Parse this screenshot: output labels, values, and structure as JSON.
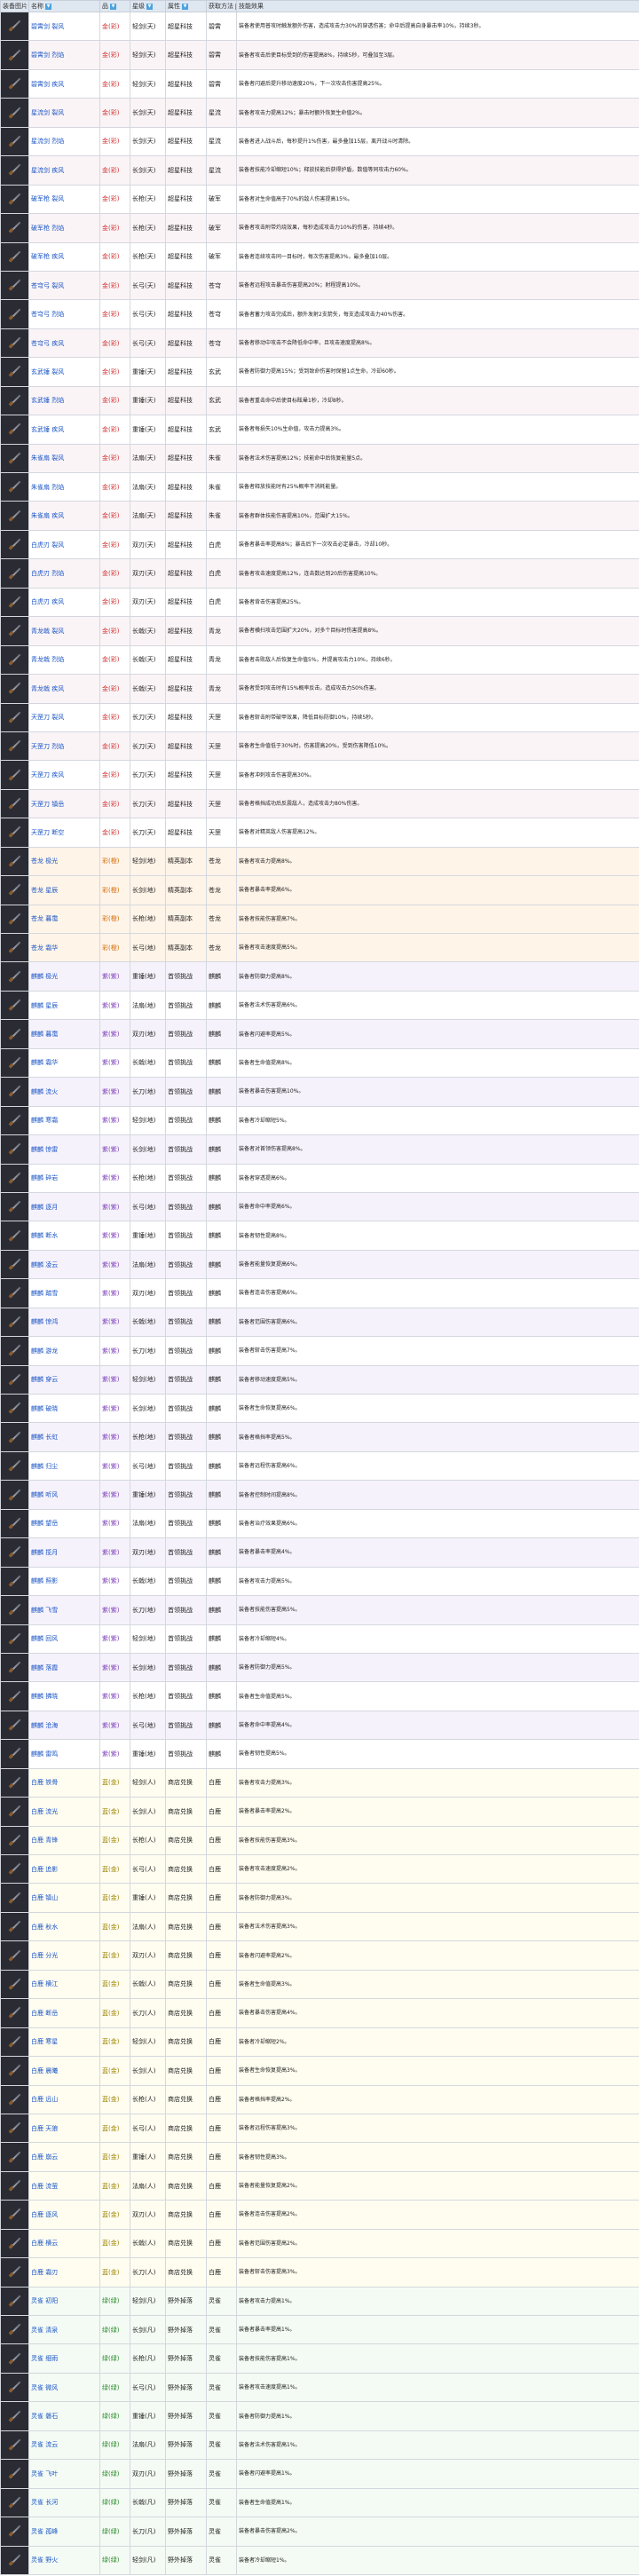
{
  "headers": [
    "装备图片",
    "名称",
    "品",
    "星级",
    "属性",
    "获取方法",
    "技能效果"
  ],
  "rows": [
    {
      "name": "碧霄剑 裂风",
      "grade": "金(彩)",
      "attr": "轻剑(天)",
      "source": "超星科技",
      "aff": "碧霄",
      "desc": "装备者使用普攻时触发额外伤害，造成攻击力30%的穿透伤害；命中后提高自身暴击率10%，持续3秒。",
      "tone": "red"
    },
    {
      "name": "碧霄剑 烈焰",
      "grade": "金(彩)",
      "attr": "轻剑(天)",
      "source": "超星科技",
      "aff": "碧霄",
      "desc": "装备者攻击后使目标受到的伤害提高8%，持续5秒，可叠加至3层。",
      "tone": "red"
    },
    {
      "name": "碧霄剑 疾风",
      "grade": "金(彩)",
      "attr": "轻剑(天)",
      "source": "超星科技",
      "aff": "碧霄",
      "desc": "装备者闪避后提升移动速度20%，下一次攻击伤害提高25%。",
      "tone": "red"
    },
    {
      "name": "星流剑 裂风",
      "grade": "金(彩)",
      "attr": "长剑(天)",
      "source": "超星科技",
      "aff": "星流",
      "desc": "装备者攻击力提高12%；暴击时额外恢复生命值2%。",
      "tone": "red"
    },
    {
      "name": "星流剑 烈焰",
      "grade": "金(彩)",
      "attr": "长剑(天)",
      "source": "超星科技",
      "aff": "星流",
      "desc": "装备者进入战斗后，每秒提升1%伤害，最多叠加15层，离开战斗时清除。",
      "tone": "red"
    },
    {
      "name": "星流剑 疾风",
      "grade": "金(彩)",
      "attr": "长剑(天)",
      "source": "超星科技",
      "aff": "星流",
      "desc": "装备者技能冷却缩短10%；释放技能后获得护盾，数值等同攻击力60%。",
      "tone": "red"
    },
    {
      "name": "破军枪 裂风",
      "grade": "金(彩)",
      "attr": "长枪(天)",
      "source": "超星科技",
      "aff": "破军",
      "desc": "装备者对生命值高于70%的敌人伤害提高15%。",
      "tone": "red"
    },
    {
      "name": "破军枪 烈焰",
      "grade": "金(彩)",
      "attr": "长枪(天)",
      "source": "超星科技",
      "aff": "破军",
      "desc": "装备者攻击附带灼烧效果，每秒造成攻击力10%的伤害，持续4秒。",
      "tone": "red"
    },
    {
      "name": "破军枪 疾风",
      "grade": "金(彩)",
      "attr": "长枪(天)",
      "source": "超星科技",
      "aff": "破军",
      "desc": "装备者连续攻击同一目标时，每次伤害提高3%，最多叠加10层。",
      "tone": "red"
    },
    {
      "name": "苍穹弓 裂风",
      "grade": "金(彩)",
      "attr": "长弓(天)",
      "source": "超星科技",
      "aff": "苍穹",
      "desc": "装备者远程攻击暴击伤害提高20%；射程提高10%。",
      "tone": "red"
    },
    {
      "name": "苍穹弓 烈焰",
      "grade": "金(彩)",
      "attr": "长弓(天)",
      "source": "超星科技",
      "aff": "苍穹",
      "desc": "装备者蓄力攻击完成后，额外发射2支箭矢，每支造成攻击力40%伤害。",
      "tone": "red"
    },
    {
      "name": "苍穹弓 疾风",
      "grade": "金(彩)",
      "attr": "长弓(天)",
      "source": "超星科技",
      "aff": "苍穹",
      "desc": "装备者移动中攻击不会降低命中率，且攻击速度提高8%。",
      "tone": "red"
    },
    {
      "name": "玄武锤 裂风",
      "grade": "金(彩)",
      "attr": "重锤(天)",
      "source": "超星科技",
      "aff": "玄武",
      "desc": "装备者防御力提高15%；受到致命伤害时保留1点生命，冷却60秒。",
      "tone": "red"
    },
    {
      "name": "玄武锤 烈焰",
      "grade": "金(彩)",
      "attr": "重锤(天)",
      "source": "超星科技",
      "aff": "玄武",
      "desc": "装备者重击命中后使目标眩晕1秒，冷却8秒。",
      "tone": "red"
    },
    {
      "name": "玄武锤 疾风",
      "grade": "金(彩)",
      "attr": "重锤(天)",
      "source": "超星科技",
      "aff": "玄武",
      "desc": "装备者每损失10%生命值，攻击力提高3%。",
      "tone": "red"
    },
    {
      "name": "朱雀扇 裂风",
      "grade": "金(彩)",
      "attr": "法扇(天)",
      "source": "超星科技",
      "aff": "朱雀",
      "desc": "装备者法术伤害提高12%；技能命中后恢复能量5点。",
      "tone": "red"
    },
    {
      "name": "朱雀扇 烈焰",
      "grade": "金(彩)",
      "attr": "法扇(天)",
      "source": "超星科技",
      "aff": "朱雀",
      "desc": "装备者释放技能时有25%概率不消耗能量。",
      "tone": "red"
    },
    {
      "name": "朱雀扇 疾风",
      "grade": "金(彩)",
      "attr": "法扇(天)",
      "source": "超星科技",
      "aff": "朱雀",
      "desc": "装备者群体技能伤害提高10%，范围扩大15%。",
      "tone": "red"
    },
    {
      "name": "白虎刃 裂风",
      "grade": "金(彩)",
      "attr": "双刃(天)",
      "source": "超星科技",
      "aff": "白虎",
      "desc": "装备者暴击率提高8%；暴击后下一次攻击必定暴击，冷却10秒。",
      "tone": "red"
    },
    {
      "name": "白虎刃 烈焰",
      "grade": "金(彩)",
      "attr": "双刃(天)",
      "source": "超星科技",
      "aff": "白虎",
      "desc": "装备者攻击速度提高12%，连击数达到20后伤害提高10%。",
      "tone": "red"
    },
    {
      "name": "白虎刃 疾风",
      "grade": "金(彩)",
      "attr": "双刃(天)",
      "source": "超星科技",
      "aff": "白虎",
      "desc": "装备者背击伤害提高25%。",
      "tone": "red"
    },
    {
      "name": "青龙戟 裂风",
      "grade": "金(彩)",
      "attr": "长戟(天)",
      "source": "超星科技",
      "aff": "青龙",
      "desc": "装备者横扫攻击范围扩大20%，对多个目标时伤害提高8%。",
      "tone": "red"
    },
    {
      "name": "青龙戟 烈焰",
      "grade": "金(彩)",
      "attr": "长戟(天)",
      "source": "超星科技",
      "aff": "青龙",
      "desc": "装备者击败敌人后恢复生命值5%，并提高攻击力10%，持续6秒。",
      "tone": "red"
    },
    {
      "name": "青龙戟 疾风",
      "grade": "金(彩)",
      "attr": "长戟(天)",
      "source": "超星科技",
      "aff": "青龙",
      "desc": "装备者受到攻击时有15%概率反击，造成攻击力50%伤害。",
      "tone": "red"
    },
    {
      "name": "天罡刀 裂风",
      "grade": "金(彩)",
      "attr": "长刀(天)",
      "source": "超星科技",
      "aff": "天罡",
      "desc": "装备者斩击附带破甲效果，降低目标防御10%，持续5秒。",
      "tone": "red"
    },
    {
      "name": "天罡刀 烈焰",
      "grade": "金(彩)",
      "attr": "长刀(天)",
      "source": "超星科技",
      "aff": "天罡",
      "desc": "装备者生命值低于30%时，伤害提高20%，受到伤害降低10%。",
      "tone": "red"
    },
    {
      "name": "天罡刀 疾风",
      "grade": "金(彩)",
      "attr": "长刀(天)",
      "source": "超星科技",
      "aff": "天罡",
      "desc": "装备者冲刺攻击伤害提高30%。",
      "tone": "red"
    },
    {
      "name": "天罡刀 镇岳",
      "grade": "金(彩)",
      "attr": "长刀(天)",
      "source": "超星科技",
      "aff": "天罡",
      "desc": "装备者格挡成功后反震敌人，造成攻击力80%伤害。",
      "tone": "red"
    },
    {
      "name": "天罡刀 断空",
      "grade": "金(彩)",
      "attr": "长刀(天)",
      "source": "超星科技",
      "aff": "天罡",
      "desc": "装备者对精英敌人伤害提高12%。",
      "tone": "red"
    },
    {
      "name": "苍龙 极光",
      "grade": "彩(橙)",
      "attr": "轻剑(地)",
      "source": "精英副本",
      "aff": "苍龙",
      "desc": "装备者攻击力提高8%。",
      "tone": "or"
    },
    {
      "name": "苍龙 星辰",
      "grade": "彩(橙)",
      "attr": "长剑(地)",
      "source": "精英副本",
      "aff": "苍龙",
      "desc": "装备者暴击率提高6%。",
      "tone": "or"
    },
    {
      "name": "苍龙 暮霭",
      "grade": "彩(橙)",
      "attr": "长枪(地)",
      "source": "精英副本",
      "aff": "苍龙",
      "desc": "装备者技能伤害提高7%。",
      "tone": "or"
    },
    {
      "name": "苍龙 霜华",
      "grade": "彩(橙)",
      "attr": "长弓(地)",
      "source": "精英副本",
      "aff": "苍龙",
      "desc": "装备者攻击速度提高5%。",
      "tone": "or"
    },
    {
      "name": "麒麟 极光",
      "grade": "紫(紫)",
      "attr": "重锤(地)",
      "source": "首领挑战",
      "aff": "麒麟",
      "desc": "装备者防御力提高8%。",
      "tone": "pu"
    },
    {
      "name": "麒麟 星辰",
      "grade": "紫(紫)",
      "attr": "法扇(地)",
      "source": "首领挑战",
      "aff": "麒麟",
      "desc": "装备者法术伤害提高6%。",
      "tone": "pu"
    },
    {
      "name": "麒麟 暮霭",
      "grade": "紫(紫)",
      "attr": "双刃(地)",
      "source": "首领挑战",
      "aff": "麒麟",
      "desc": "装备者闪避率提高5%。",
      "tone": "pu"
    },
    {
      "name": "麒麟 霜华",
      "grade": "紫(紫)",
      "attr": "长戟(地)",
      "source": "首领挑战",
      "aff": "麒麟",
      "desc": "装备者生命值提高8%。",
      "tone": "pu"
    },
    {
      "name": "麒麟 流火",
      "grade": "紫(紫)",
      "attr": "长刀(地)",
      "source": "首领挑战",
      "aff": "麒麟",
      "desc": "装备者暴击伤害提高10%。",
      "tone": "pu"
    },
    {
      "name": "麒麟 寒霜",
      "grade": "紫(紫)",
      "attr": "轻剑(地)",
      "source": "首领挑战",
      "aff": "麒麟",
      "desc": "装备者冷却缩短5%。",
      "tone": "pu"
    },
    {
      "name": "麒麟 惊雷",
      "grade": "紫(紫)",
      "attr": "长剑(地)",
      "source": "首领挑战",
      "aff": "麒麟",
      "desc": "装备者对首领伤害提高8%。",
      "tone": "pu"
    },
    {
      "name": "麒麟 碎岩",
      "grade": "紫(紫)",
      "attr": "长枪(地)",
      "source": "首领挑战",
      "aff": "麒麟",
      "desc": "装备者穿透提高6%。",
      "tone": "pu"
    },
    {
      "name": "麒麟 逐月",
      "grade": "紫(紫)",
      "attr": "长弓(地)",
      "source": "首领挑战",
      "aff": "麒麟",
      "desc": "装备者命中率提高6%。",
      "tone": "pu"
    },
    {
      "name": "麒麟 断水",
      "grade": "紫(紫)",
      "attr": "重锤(地)",
      "source": "首领挑战",
      "aff": "麒麟",
      "desc": "装备者韧性提高8%。",
      "tone": "pu"
    },
    {
      "name": "麒麟 凌云",
      "grade": "紫(紫)",
      "attr": "法扇(地)",
      "source": "首领挑战",
      "aff": "麒麟",
      "desc": "装备者能量恢复提高6%。",
      "tone": "pu"
    },
    {
      "name": "麒麟 踏雪",
      "grade": "紫(紫)",
      "attr": "双刃(地)",
      "source": "首领挑战",
      "aff": "麒麟",
      "desc": "装备者连击伤害提高6%。",
      "tone": "pu"
    },
    {
      "name": "麒麟 惊鸿",
      "grade": "紫(紫)",
      "attr": "长戟(地)",
      "source": "首领挑战",
      "aff": "麒麟",
      "desc": "装备者范围伤害提高6%。",
      "tone": "pu"
    },
    {
      "name": "麒麟 游龙",
      "grade": "紫(紫)",
      "attr": "长刀(地)",
      "source": "首领挑战",
      "aff": "麒麟",
      "desc": "装备者斩击伤害提高7%。",
      "tone": "pu"
    },
    {
      "name": "麒麟 穿云",
      "grade": "紫(紫)",
      "attr": "轻剑(地)",
      "source": "首领挑战",
      "aff": "麒麟",
      "desc": "装备者移动速度提高5%。",
      "tone": "pu"
    },
    {
      "name": "麒麟 破晓",
      "grade": "紫(紫)",
      "attr": "长剑(地)",
      "source": "首领挑战",
      "aff": "麒麟",
      "desc": "装备者生命恢复提高6%。",
      "tone": "pu"
    },
    {
      "name": "麒麟 长虹",
      "grade": "紫(紫)",
      "attr": "长枪(地)",
      "source": "首领挑战",
      "aff": "麒麟",
      "desc": "装备者格挡率提高5%。",
      "tone": "pu"
    },
    {
      "name": "麒麟 归尘",
      "grade": "紫(紫)",
      "attr": "长弓(地)",
      "source": "首领挑战",
      "aff": "麒麟",
      "desc": "装备者远程伤害提高6%。",
      "tone": "pu"
    },
    {
      "name": "麒麟 听风",
      "grade": "紫(紫)",
      "attr": "重锤(地)",
      "source": "首领挑战",
      "aff": "麒麟",
      "desc": "装备者控制时间提高8%。",
      "tone": "pu"
    },
    {
      "name": "麒麟 望岳",
      "grade": "紫(紫)",
      "attr": "法扇(地)",
      "source": "首领挑战",
      "aff": "麒麟",
      "desc": "装备者治疗效果提高6%。",
      "tone": "pu"
    },
    {
      "name": "麒麟 揽月",
      "grade": "紫(紫)",
      "attr": "双刃(地)",
      "source": "首领挑战",
      "aff": "麒麟",
      "desc": "装备者暴击率提高4%。",
      "tone": "pu"
    },
    {
      "name": "麒麟 照影",
      "grade": "紫(紫)",
      "attr": "长戟(地)",
      "source": "首领挑战",
      "aff": "麒麟",
      "desc": "装备者攻击力提高5%。",
      "tone": "pu"
    },
    {
      "name": "麒麟 飞雪",
      "grade": "紫(紫)",
      "attr": "长刀(地)",
      "source": "首领挑战",
      "aff": "麒麟",
      "desc": "装备者技能伤害提高5%。",
      "tone": "pu"
    },
    {
      "name": "麒麟 回风",
      "grade": "紫(紫)",
      "attr": "轻剑(地)",
      "source": "首领挑战",
      "aff": "麒麟",
      "desc": "装备者冷却缩短4%。",
      "tone": "pu"
    },
    {
      "name": "麒麟 落霞",
      "grade": "紫(紫)",
      "attr": "长剑(地)",
      "source": "首领挑战",
      "aff": "麒麟",
      "desc": "装备者防御力提高5%。",
      "tone": "pu"
    },
    {
      "name": "麒麟 拂晓",
      "grade": "紫(紫)",
      "attr": "长枪(地)",
      "source": "首领挑战",
      "aff": "麒麟",
      "desc": "装备者生命值提高5%。",
      "tone": "pu"
    },
    {
      "name": "麒麟 沧海",
      "grade": "紫(紫)",
      "attr": "长弓(地)",
      "source": "首领挑战",
      "aff": "麒麟",
      "desc": "装备者命中率提高4%。",
      "tone": "pu"
    },
    {
      "name": "麒麟 雷鸣",
      "grade": "紫(紫)",
      "attr": "重锤(地)",
      "source": "首领挑战",
      "aff": "麒麟",
      "desc": "装备者韧性提高5%。",
      "tone": "pu"
    },
    {
      "name": "白鹿 铁骨",
      "grade": "蓝(金)",
      "attr": "轻剑(人)",
      "source": "商店兑换",
      "aff": "白鹿",
      "desc": "装备者攻击力提高3%。",
      "tone": "yl"
    },
    {
      "name": "白鹿 流光",
      "grade": "蓝(金)",
      "attr": "长剑(人)",
      "source": "商店兑换",
      "aff": "白鹿",
      "desc": "装备者暴击率提高2%。",
      "tone": "yl"
    },
    {
      "name": "白鹿 青锋",
      "grade": "蓝(金)",
      "attr": "长枪(人)",
      "source": "商店兑换",
      "aff": "白鹿",
      "desc": "装备者技能伤害提高3%。",
      "tone": "yl"
    },
    {
      "name": "白鹿 追影",
      "grade": "蓝(金)",
      "attr": "长弓(人)",
      "source": "商店兑换",
      "aff": "白鹿",
      "desc": "装备者攻击速度提高2%。",
      "tone": "yl"
    },
    {
      "name": "白鹿 镇山",
      "grade": "蓝(金)",
      "attr": "重锤(人)",
      "source": "商店兑换",
      "aff": "白鹿",
      "desc": "装备者防御力提高3%。",
      "tone": "yl"
    },
    {
      "name": "白鹿 秋水",
      "grade": "蓝(金)",
      "attr": "法扇(人)",
      "source": "商店兑换",
      "aff": "白鹿",
      "desc": "装备者法术伤害提高3%。",
      "tone": "yl"
    },
    {
      "name": "白鹿 分光",
      "grade": "蓝(金)",
      "attr": "双刃(人)",
      "source": "商店兑换",
      "aff": "白鹿",
      "desc": "装备者闪避率提高2%。",
      "tone": "yl"
    },
    {
      "name": "白鹿 横江",
      "grade": "蓝(金)",
      "attr": "长戟(人)",
      "source": "商店兑换",
      "aff": "白鹿",
      "desc": "装备者生命值提高3%。",
      "tone": "yl"
    },
    {
      "name": "白鹿 断岳",
      "grade": "蓝(金)",
      "attr": "长刀(人)",
      "source": "商店兑换",
      "aff": "白鹿",
      "desc": "装备者暴击伤害提高4%。",
      "tone": "yl"
    },
    {
      "name": "白鹿 寒星",
      "grade": "蓝(金)",
      "attr": "轻剑(人)",
      "source": "商店兑换",
      "aff": "白鹿",
      "desc": "装备者冷却缩短2%。",
      "tone": "yl"
    },
    {
      "name": "白鹿 晨曦",
      "grade": "蓝(金)",
      "attr": "长剑(人)",
      "source": "商店兑换",
      "aff": "白鹿",
      "desc": "装备者生命恢复提高3%。",
      "tone": "yl"
    },
    {
      "name": "白鹿 远山",
      "grade": "蓝(金)",
      "attr": "长枪(人)",
      "source": "商店兑换",
      "aff": "白鹿",
      "desc": "装备者格挡率提高2%。",
      "tone": "yl"
    },
    {
      "name": "白鹿 天狼",
      "grade": "蓝(金)",
      "attr": "长弓(人)",
      "source": "商店兑换",
      "aff": "白鹿",
      "desc": "装备者远程伤害提高3%。",
      "tone": "yl"
    },
    {
      "name": "白鹿 崩云",
      "grade": "蓝(金)",
      "attr": "重锤(人)",
      "source": "商店兑换",
      "aff": "白鹿",
      "desc": "装备者韧性提高3%。",
      "tone": "yl"
    },
    {
      "name": "白鹿 流萤",
      "grade": "蓝(金)",
      "attr": "法扇(人)",
      "source": "商店兑换",
      "aff": "白鹿",
      "desc": "装备者能量恢复提高2%。",
      "tone": "yl"
    },
    {
      "name": "白鹿 逐风",
      "grade": "蓝(金)",
      "attr": "双刃(人)",
      "source": "商店兑换",
      "aff": "白鹿",
      "desc": "装备者连击伤害提高2%。",
      "tone": "yl"
    },
    {
      "name": "白鹿 横云",
      "grade": "蓝(金)",
      "attr": "长戟(人)",
      "source": "商店兑换",
      "aff": "白鹿",
      "desc": "装备者范围伤害提高2%。",
      "tone": "yl"
    },
    {
      "name": "白鹿 霜刃",
      "grade": "蓝(金)",
      "attr": "长刀(人)",
      "source": "商店兑换",
      "aff": "白鹿",
      "desc": "装备者斩击伤害提高3%。",
      "tone": "yl"
    },
    {
      "name": "灵雀 初阳",
      "grade": "绿(绿)",
      "attr": "轻剑(凡)",
      "source": "野外掉落",
      "aff": "灵雀",
      "desc": "装备者攻击力提高1%。",
      "tone": "gr"
    },
    {
      "name": "灵雀 清泉",
      "grade": "绿(绿)",
      "attr": "长剑(凡)",
      "source": "野外掉落",
      "aff": "灵雀",
      "desc": "装备者暴击率提高1%。",
      "tone": "gr"
    },
    {
      "name": "灵雀 细雨",
      "grade": "绿(绿)",
      "attr": "长枪(凡)",
      "source": "野外掉落",
      "aff": "灵雀",
      "desc": "装备者技能伤害提高1%。",
      "tone": "gr"
    },
    {
      "name": "灵雀 微风",
      "grade": "绿(绿)",
      "attr": "长弓(凡)",
      "source": "野外掉落",
      "aff": "灵雀",
      "desc": "装备者攻击速度提高1%。",
      "tone": "gr"
    },
    {
      "name": "灵雀 磐石",
      "grade": "绿(绿)",
      "attr": "重锤(凡)",
      "source": "野外掉落",
      "aff": "灵雀",
      "desc": "装备者防御力提高1%。",
      "tone": "gr"
    },
    {
      "name": "灵雀 流云",
      "grade": "绿(绿)",
      "attr": "法扇(凡)",
      "source": "野外掉落",
      "aff": "灵雀",
      "desc": "装备者法术伤害提高1%。",
      "tone": "gr"
    },
    {
      "name": "灵雀 飞叶",
      "grade": "绿(绿)",
      "attr": "双刃(凡)",
      "source": "野外掉落",
      "aff": "灵雀",
      "desc": "装备者闪避率提高1%。",
      "tone": "gr"
    },
    {
      "name": "灵雀 长河",
      "grade": "绿(绿)",
      "attr": "长戟(凡)",
      "source": "野外掉落",
      "aff": "灵雀",
      "desc": "装备者生命值提高1%。",
      "tone": "gr"
    },
    {
      "name": "灵雀 孤峰",
      "grade": "绿(绿)",
      "attr": "长刀(凡)",
      "source": "野外掉落",
      "aff": "灵雀",
      "desc": "装备者暴击伤害提高2%。",
      "tone": "gr"
    },
    {
      "name": "灵雀 野火",
      "grade": "绿(绿)",
      "attr": "轻剑(凡)",
      "source": "野外掉落",
      "aff": "灵雀",
      "desc": "装备者冷却缩短1%。",
      "tone": "gr"
    }
  ]
}
